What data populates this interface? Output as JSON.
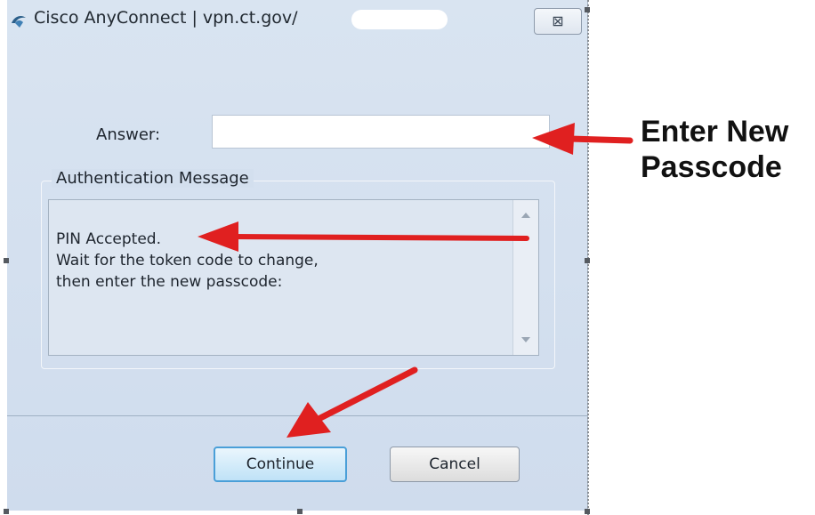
{
  "window": {
    "title": "Cisco AnyConnect | vpn.ct.gov/",
    "close_glyph": "⊠"
  },
  "form": {
    "answer_label": "Answer:",
    "answer_value": "",
    "group_title": "Authentication Message",
    "message_lines": [
      "PIN Accepted.",
      "Wait for the token code to change,",
      "then enter the new passcode:"
    ]
  },
  "buttons": {
    "continue_label": "Continue",
    "cancel_label": "Cancel"
  },
  "annotation": {
    "callout_line1": "Enter New",
    "callout_line2": "Passcode",
    "arrow_color": "#e02020"
  },
  "icons": [
    "anyconnect-logo-icon",
    "close-icon",
    "scroll-up-icon",
    "scroll-down-icon"
  ]
}
